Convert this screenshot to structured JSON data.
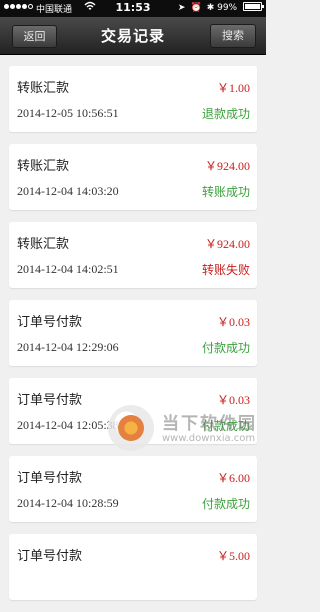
{
  "status_bar": {
    "carrier": "中国联通",
    "time": "11:53",
    "battery": "99%",
    "battery_level": 0.99
  },
  "nav": {
    "back_label": "返回",
    "title": "交易记录",
    "search_label": "搜索"
  },
  "records": [
    {
      "desc": "转账汇款",
      "amount": "￥1.00",
      "date": "2014-12-05 10:56:51",
      "status": "退款成功",
      "status_type": "ok"
    },
    {
      "desc": "转账汇款",
      "amount": "￥924.00",
      "date": "2014-12-04 14:03:20",
      "status": "转账成功",
      "status_type": "ok"
    },
    {
      "desc": "转账汇款",
      "amount": "￥924.00",
      "date": "2014-12-04 14:02:51",
      "status": "转账失败",
      "status_type": "fail"
    },
    {
      "desc": "订单号付款",
      "amount": "￥0.03",
      "date": "2014-12-04 12:29:06",
      "status": "付款成功",
      "status_type": "ok"
    },
    {
      "desc": "订单号付款",
      "amount": "￥0.03",
      "date": "2014-12-04 12:05:38",
      "status": "付款成功",
      "status_type": "ok"
    },
    {
      "desc": "订单号付款",
      "amount": "￥6.00",
      "date": "2014-12-04 10:28:59",
      "status": "付款成功",
      "status_type": "ok"
    },
    {
      "desc": "订单号付款",
      "amount": "￥5.00",
      "date": "",
      "status": "",
      "status_type": "ok"
    }
  ],
  "watermark": {
    "text": "当下软件园",
    "url": "www.downxia.com"
  },
  "colors": {
    "amount": "#c8201d",
    "success": "#3aa13a",
    "fail": "#c8201d",
    "navbar": "#2f2f2f"
  }
}
